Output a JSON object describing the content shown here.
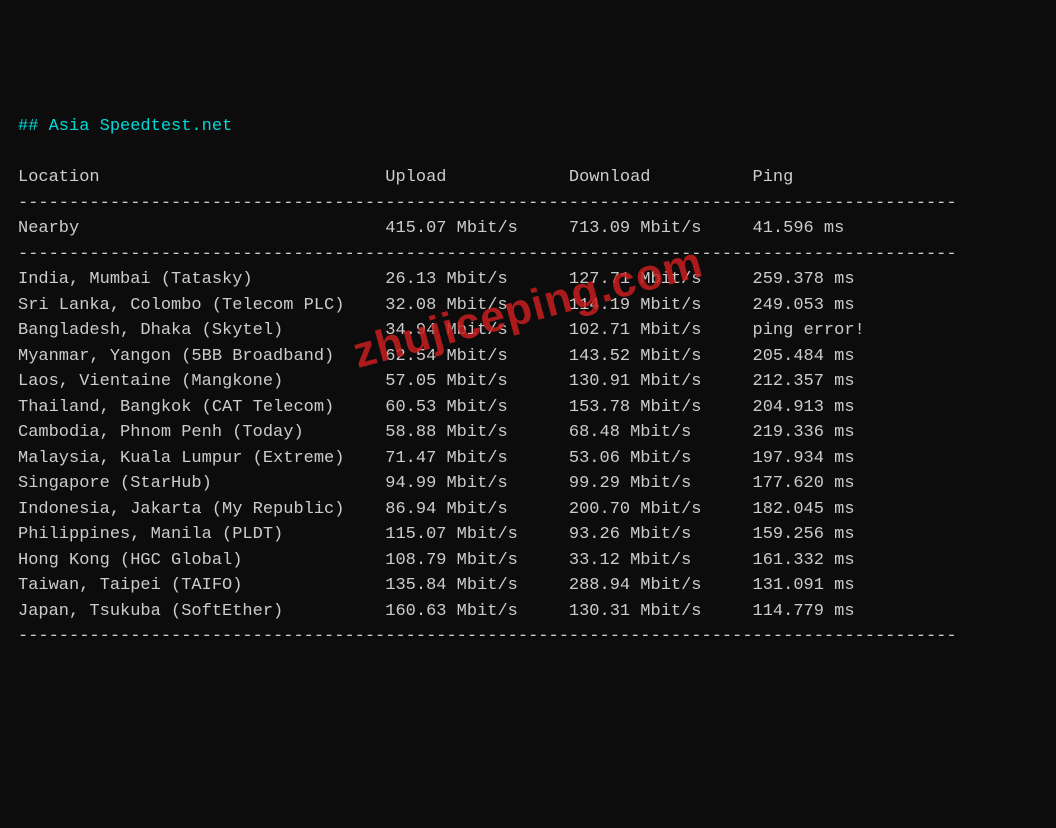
{
  "title": "## Asia Speedtest.net",
  "header": {
    "location": "Location",
    "upload": "Upload",
    "download": "Download",
    "ping": "Ping"
  },
  "nearby": {
    "location": "Nearby",
    "upload": "415.07 Mbit/s",
    "download": "713.09 Mbit/s",
    "ping": "41.596 ms"
  },
  "rows": [
    {
      "location": "India, Mumbai (Tatasky)",
      "upload": "26.13 Mbit/s",
      "download": "127.71 Mbit/s",
      "ping": "259.378 ms"
    },
    {
      "location": "Sri Lanka, Colombo (Telecom PLC)",
      "upload": "32.08 Mbit/s",
      "download": "114.19 Mbit/s",
      "ping": "249.053 ms"
    },
    {
      "location": "Bangladesh, Dhaka (Skytel)",
      "upload": "34.94 Mbit/s",
      "download": "102.71 Mbit/s",
      "ping": "ping error!"
    },
    {
      "location": "Myanmar, Yangon (5BB Broadband)",
      "upload": "62.54 Mbit/s",
      "download": "143.52 Mbit/s",
      "ping": "205.484 ms"
    },
    {
      "location": "Laos, Vientaine (Mangkone)",
      "upload": "57.05 Mbit/s",
      "download": "130.91 Mbit/s",
      "ping": "212.357 ms"
    },
    {
      "location": "Thailand, Bangkok (CAT Telecom)",
      "upload": "60.53 Mbit/s",
      "download": "153.78 Mbit/s",
      "ping": "204.913 ms"
    },
    {
      "location": "Cambodia, Phnom Penh (Today)",
      "upload": "58.88 Mbit/s",
      "download": "68.48 Mbit/s",
      "ping": "219.336 ms"
    },
    {
      "location": "Malaysia, Kuala Lumpur (Extreme)",
      "upload": "71.47 Mbit/s",
      "download": "53.06 Mbit/s",
      "ping": "197.934 ms"
    },
    {
      "location": "Singapore (StarHub)",
      "upload": "94.99 Mbit/s",
      "download": "99.29 Mbit/s",
      "ping": "177.620 ms"
    },
    {
      "location": "Indonesia, Jakarta (My Republic)",
      "upload": "86.94 Mbit/s",
      "download": "200.70 Mbit/s",
      "ping": "182.045 ms"
    },
    {
      "location": "Philippines, Manila (PLDT)",
      "upload": "115.07 Mbit/s",
      "download": "93.26 Mbit/s",
      "ping": "159.256 ms"
    },
    {
      "location": "Hong Kong (HGC Global)",
      "upload": "108.79 Mbit/s",
      "download": "33.12 Mbit/s",
      "ping": "161.332 ms"
    },
    {
      "location": "Taiwan, Taipei (TAIFO)",
      "upload": "135.84 Mbit/s",
      "download": "288.94 Mbit/s",
      "ping": "131.091 ms"
    },
    {
      "location": "Japan, Tsukuba (SoftEther)",
      "upload": "160.63 Mbit/s",
      "download": "130.31 Mbit/s",
      "ping": "114.779 ms"
    }
  ],
  "watermark": "zhujiceping.com",
  "divider": "--------------------------------------------------------------------------------------------"
}
